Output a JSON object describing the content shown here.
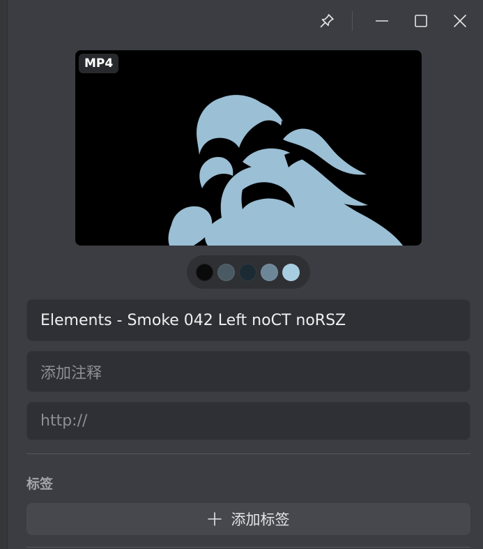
{
  "window": {
    "pin_icon": "pin-icon",
    "minimize_icon": "minimize-icon",
    "maximize_icon": "maximize-icon",
    "close_icon": "close-icon"
  },
  "preview": {
    "format_badge": "MP4"
  },
  "palette": {
    "colors": [
      "#0a0a0a",
      "#4a5a63",
      "#1c2a33",
      "#6e8798",
      "#a8cde0"
    ]
  },
  "fields": {
    "title_value": "Elements - Smoke 042 Left noCT noRSZ",
    "note_placeholder": "添加注释",
    "url_placeholder": "http://"
  },
  "tags": {
    "section_label": "标签",
    "add_label": "添加标签",
    "add_icon": "plus-icon"
  }
}
